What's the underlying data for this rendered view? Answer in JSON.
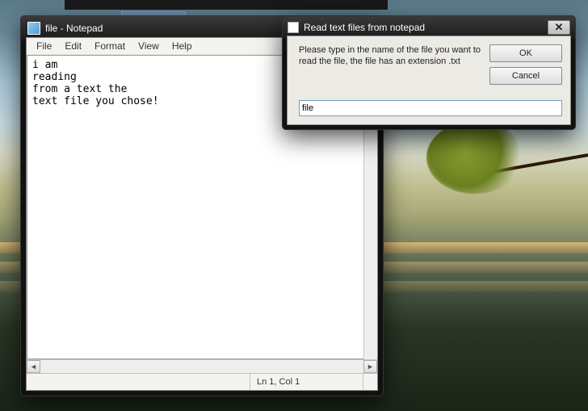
{
  "notepad": {
    "title": "file - Notepad",
    "menu": {
      "file": "File",
      "edit": "Edit",
      "format": "Format",
      "view": "View",
      "help": "Help"
    },
    "content": "i am\nreading\nfrom a text the\ntext file you chose!",
    "status": "Ln 1, Col 1"
  },
  "dialog": {
    "title": "Read text files from notepad",
    "message": "Please type in the name of the file you want to read the file, the file has an extension .txt",
    "ok": "OK",
    "cancel": "Cancel",
    "input_value": "file"
  }
}
